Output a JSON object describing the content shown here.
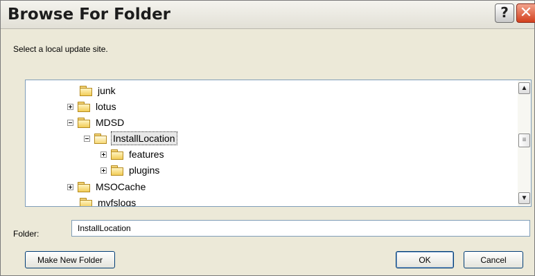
{
  "window": {
    "title": "Browse For Folder",
    "help_label": "?",
    "close_label": "✕"
  },
  "instruction": "Select a local update site.",
  "tree": {
    "items": [
      {
        "label": "junk",
        "expander": "none",
        "open": false,
        "selected": false
      },
      {
        "label": "lotus",
        "expander": "plus",
        "open": false,
        "selected": false
      },
      {
        "label": "MDSD",
        "expander": "minus",
        "open": false,
        "selected": false
      },
      {
        "label": "InstallLocation",
        "expander": "minus",
        "open": true,
        "selected": true
      },
      {
        "label": "features",
        "expander": "plus",
        "open": false,
        "selected": false
      },
      {
        "label": "plugins",
        "expander": "plus",
        "open": false,
        "selected": false
      },
      {
        "label": "MSOCache",
        "expander": "plus",
        "open": false,
        "selected": false
      },
      {
        "label": "myfslogs",
        "expander": "none",
        "open": false,
        "selected": false
      }
    ]
  },
  "scrollbar": {
    "up_glyph": "▲",
    "down_glyph": "▼",
    "thumb_glyph": "≡"
  },
  "folder_field": {
    "label": "Folder:",
    "value": "InstallLocation"
  },
  "buttons": {
    "make_new_folder": "Make New Folder",
    "ok": "OK",
    "cancel": "Cancel"
  },
  "icons": {
    "folder": "folder-icon",
    "expander_plus": "plus-expander-icon",
    "expander_minus": "minus-expander-icon"
  },
  "colors": {
    "dialog_bg": "#ece9d8",
    "close_button": "#d2401e",
    "tree_border": "#7f9db9"
  }
}
